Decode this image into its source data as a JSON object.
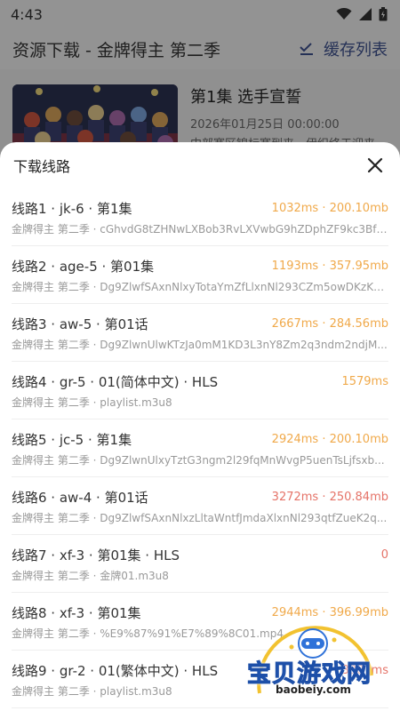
{
  "status_bar": {
    "time": "4:43"
  },
  "app_bar": {
    "title": "资源下载 - 金牌得主 第二季",
    "cache_label": "缓存列表"
  },
  "episode": {
    "title": "第1集 选手宣誓",
    "date": "2026年01月25日 00:00:00",
    "description": "中部赛区锦标赛到来，伊织终于迎来"
  },
  "sheet": {
    "title": "下载线路",
    "routes": [
      {
        "name": "线路1 · jk-6 · 第1集",
        "meta": "1032ms · 200.10mb",
        "sub": "金牌得主 第二季 · cGhvdG8tZHNwLXBob3RvLXVwbG9hZDphZF9kc3Bfc...",
        "color": "#f0a94a"
      },
      {
        "name": "线路2 · age-5 · 第01集",
        "meta": "1193ms · 357.95mb",
        "sub": "金牌得主 第二季 · Dg9ZlwfSAxnNlxyTotaYmZfLlxnNl293CZm5owDKzKv...",
        "color": "#f0a94a"
      },
      {
        "name": "线路3 · aw-5 · 第01话",
        "meta": "2667ms · 284.56mb",
        "sub": "金牌得主 第二季 · Dg9ZlwnUlwKTzJa0mM1KD3L3nY8Zm2q3ndm2ndjM...",
        "color": "#f0a94a"
      },
      {
        "name": "线路4 · gr-5 · 01(简体中文) · HLS",
        "meta": "1579ms",
        "sub": "金牌得主 第二季 · playlist.m3u8",
        "color": "#f0a94a"
      },
      {
        "name": "线路5 · jc-5 · 第1集",
        "meta": "2924ms · 200.10mb",
        "sub": "金牌得主 第二季 · Dg9ZlwnUlxyTztG3ngm2l29fqMnWvgP5uenTsLjfsxb...",
        "color": "#f0a94a"
      },
      {
        "name": "线路6 · aw-4 · 第01话",
        "meta": "3272ms · 250.84mb",
        "sub": "金牌得主 第二季 · Dg9ZlwfSAxnNlxzLltaWntfJmdaXlxnNl293qtfZueK2q...",
        "color": "#e57368"
      },
      {
        "name": "线路7 · xf-3 · 第01集 · HLS",
        "meta": "0",
        "sub": "金牌得主 第二季 · 金牌01.m3u8",
        "color": "#e57368"
      },
      {
        "name": "线路8 · xf-3 · 第01集",
        "meta": "2944ms · 396.99mb",
        "sub": "金牌得主 第二季 · %E9%87%91%E7%89%8C01.mp4",
        "color": "#f0a94a"
      },
      {
        "name": "线路9 · gr-2 · 01(繁体中文) · HLS",
        "meta": "3387ms",
        "sub": "金牌得主 第二季 · playlist.m3u8",
        "color": "#e57368"
      }
    ]
  },
  "watermark": {
    "name": "宝贝游戏网",
    "url": "baobeiy.com"
  }
}
